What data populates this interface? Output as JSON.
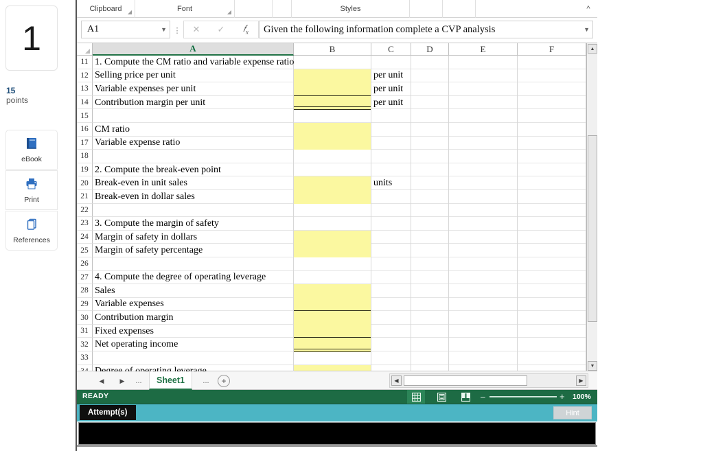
{
  "left_rail": {
    "question_number": "1",
    "points_value": "15",
    "points_label": "points",
    "buttons": [
      {
        "name": "ebook",
        "label": "eBook",
        "icon": "book-icon"
      },
      {
        "name": "print",
        "label": "Print",
        "icon": "printer-icon"
      },
      {
        "name": "references",
        "label": "References",
        "icon": "copy-pages-icon"
      }
    ]
  },
  "ribbon": {
    "groups": [
      {
        "label": "Clipboard",
        "has_dialog_launcher": true
      },
      {
        "label": "Font",
        "has_dialog_launcher": true
      },
      {
        "label": "",
        "has_dialog_launcher": false
      },
      {
        "label": "",
        "has_dialog_launcher": false
      },
      {
        "label": "Styles",
        "has_dialog_launcher": false
      },
      {
        "label": "",
        "has_dialog_launcher": false
      },
      {
        "label": "",
        "has_dialog_launcher": false
      },
      {
        "label": "",
        "has_dialog_launcher": false
      }
    ],
    "collapse_icon": "chevron-up-icon"
  },
  "formula_bar": {
    "name_box_value": "A1",
    "name_box_dropdown_icon": "chevron-down-icon",
    "cancel_icon": "cancel-x-icon",
    "enter_icon": "check-icon",
    "function_icon": "fx-icon",
    "formula_value": "Given the following information complete a CVP analysis",
    "expand_icon": "chevron-down-icon"
  },
  "grid": {
    "selected_column": "A",
    "column_headers": [
      "A",
      "B",
      "C",
      "D",
      "E",
      "F"
    ],
    "rows": [
      {
        "num": "11",
        "a": "1. Compute the CM ratio and variable expense ratio",
        "b": "",
        "c": "",
        "b_style": "plain"
      },
      {
        "num": "12",
        "a": "Selling price per unit",
        "b": "",
        "c": "per unit",
        "b_style": "yellow"
      },
      {
        "num": "13",
        "a": "Variable expenses per unit",
        "b": "",
        "c": "per unit",
        "b_style": "yellow-underline-bottom"
      },
      {
        "num": "14",
        "a": "Contribution margin per unit",
        "b": "",
        "c": "per unit",
        "b_style": "yellow-double-bottom"
      },
      {
        "num": "15",
        "a": "",
        "b": "",
        "c": "",
        "b_style": "plain"
      },
      {
        "num": "16",
        "a": "CM ratio",
        "b": "",
        "c": "",
        "b_style": "yellow"
      },
      {
        "num": "17",
        "a": "Variable expense ratio",
        "b": "",
        "c": "",
        "b_style": "yellow"
      },
      {
        "num": "18",
        "a": "",
        "b": "",
        "c": "",
        "b_style": "plain"
      },
      {
        "num": "19",
        "a": "2. Compute the break-even point",
        "b": "",
        "c": "",
        "b_style": "plain"
      },
      {
        "num": "20",
        "a": "Break-even in unit sales",
        "b": "",
        "c": "units",
        "b_style": "yellow"
      },
      {
        "num": "21",
        "a": "Break-even in dollar sales",
        "b": "",
        "c": "",
        "b_style": "yellow"
      },
      {
        "num": "22",
        "a": "",
        "b": "",
        "c": "",
        "b_style": "plain"
      },
      {
        "num": "23",
        "a": "3. Compute the margin of safety",
        "b": "",
        "c": "",
        "b_style": "plain"
      },
      {
        "num": "24",
        "a": "Margin of safety in dollars",
        "b": "",
        "c": "",
        "b_style": "yellow"
      },
      {
        "num": "25",
        "a": "Margin of safety percentage",
        "b": "",
        "c": "",
        "b_style": "yellow"
      },
      {
        "num": "26",
        "a": "",
        "b": "",
        "c": "",
        "b_style": "plain"
      },
      {
        "num": "27",
        "a": "4. Compute the degree of operating leverage",
        "b": "",
        "c": "",
        "b_style": "plain"
      },
      {
        "num": "28",
        "a": "Sales",
        "b": "",
        "c": "",
        "b_style": "yellow"
      },
      {
        "num": "29",
        "a": "Variable expenses",
        "b": "",
        "c": "",
        "b_style": "yellow-underline-bottom"
      },
      {
        "num": "30",
        "a": "Contribution margin",
        "b": "",
        "c": "",
        "b_style": "yellow"
      },
      {
        "num": "31",
        "a": "Fixed expenses",
        "b": "",
        "c": "",
        "b_style": "yellow-underline-bottom"
      },
      {
        "num": "32",
        "a": "Net operating income",
        "b": "",
        "c": "",
        "b_style": "yellow-double-bottom"
      },
      {
        "num": "33",
        "a": "",
        "b": "",
        "c": "",
        "b_style": "plain"
      },
      {
        "num": "34",
        "a": "Degree of operating leverage",
        "b": "",
        "c": "",
        "b_style": "yellow"
      }
    ]
  },
  "sheet_tabs": {
    "prev_icon": "triangle-left-icon",
    "next_icon": "triangle-right-icon",
    "dots_left": "...",
    "active_tab": "Sheet1",
    "dots_right": "...",
    "add_icon": "plus-circle-icon"
  },
  "status_bar": {
    "mode": "READY",
    "view_normal_icon": "grid-view-icon",
    "view_layout_icon": "page-layout-icon",
    "view_break_icon": "page-break-icon",
    "zoom_out_icon": "minus-icon",
    "zoom_in_icon": "plus-icon",
    "zoom_level": "100%"
  },
  "attempts_bar": {
    "label": "Attempt(s)",
    "hint_label": "Hint"
  },
  "colors": {
    "excel_green": "#1d6b44",
    "tab_green": "#217346",
    "cell_highlight_yellow": "#fbf8a0",
    "attempts_teal": "#4cb5c4",
    "points_blue": "#1f4e79"
  }
}
